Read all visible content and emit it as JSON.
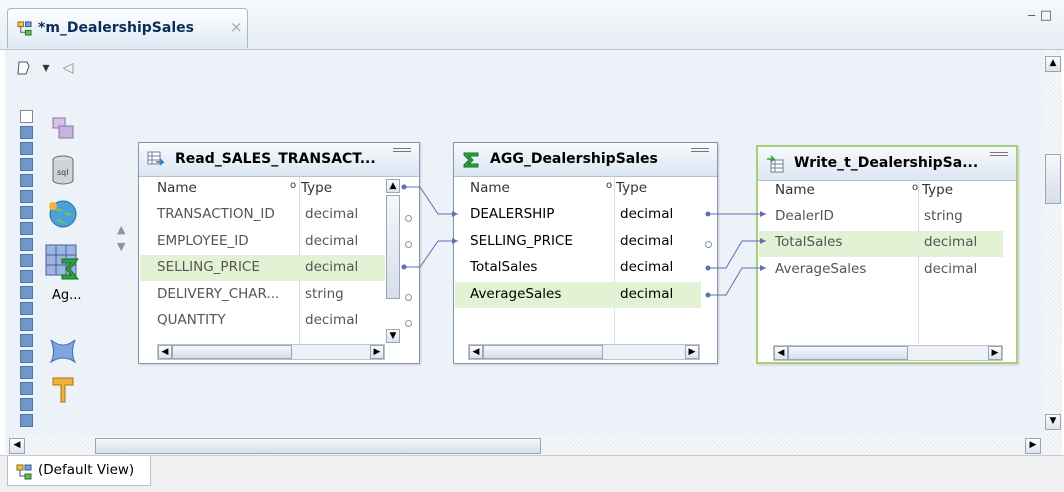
{
  "editor": {
    "tab_title": "*m_DealershipSales",
    "close_glyph": "×",
    "window_controls": "‒□"
  },
  "palette": {
    "collapse_glyph": "◁",
    "dropdown_glyph": "▾",
    "aggregator_label": "Ag...",
    "icons": [
      "mapping-icon",
      "source-icon",
      "lookup-icon",
      "aggregator-icon",
      "router-icon",
      "filter-icon"
    ]
  },
  "transformations": {
    "read": {
      "title": "Read_SALES_TRANSACT...",
      "col_name": "Name",
      "col_type": "Type",
      "rows": [
        {
          "name": "TRANSACTION_ID",
          "type": "decimal"
        },
        {
          "name": "EMPLOYEE_ID",
          "type": "decimal"
        },
        {
          "name": "SELLING_PRICE",
          "type": "decimal"
        },
        {
          "name": "DELIVERY_CHAR...",
          "type": "string"
        },
        {
          "name": "QUANTITY",
          "type": "decimal"
        }
      ]
    },
    "agg": {
      "title": "AGG_DealershipSales",
      "col_name": "Name",
      "col_type": "Type",
      "rows": [
        {
          "name": "DEALERSHIP",
          "type": "decimal"
        },
        {
          "name": "SELLING_PRICE",
          "type": "decimal"
        },
        {
          "name": "TotalSales",
          "type": "decimal"
        },
        {
          "name": "AverageSales",
          "type": "decimal"
        }
      ]
    },
    "write": {
      "title": "Write_t_DealershipSa...",
      "col_name": "Name",
      "col_type": "Type",
      "rows": [
        {
          "name": "DealerID",
          "type": "string"
        },
        {
          "name": "TotalSales",
          "type": "decimal"
        },
        {
          "name": "AverageSales",
          "type": "decimal"
        }
      ]
    }
  },
  "view_tab": {
    "label": "(Default View)"
  },
  "colors": {
    "highlight": "#e3f1d4",
    "link": "#5d6fb8",
    "write_border": "#a6d07a"
  }
}
